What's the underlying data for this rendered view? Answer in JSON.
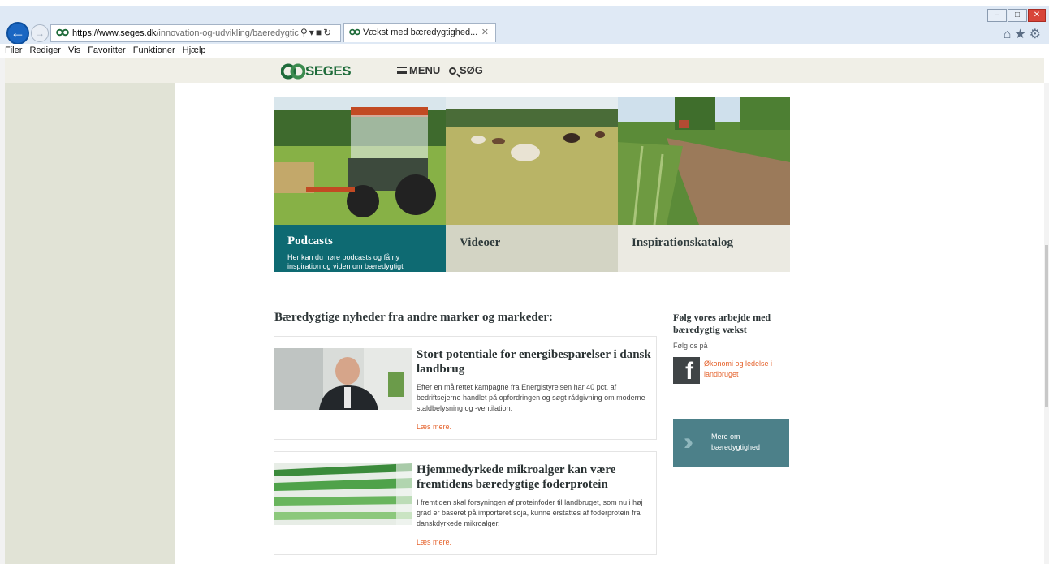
{
  "browser": {
    "url_host": "https://www.seges.dk",
    "url_path": "/innovation-og-udvikling/baeredygtic",
    "tab_title": "Vækst med bæredygtighed...",
    "menu": [
      "Filer",
      "Rediger",
      "Vis",
      "Favoritter",
      "Funktioner",
      "Hjælp"
    ]
  },
  "header": {
    "logo": "SEGES",
    "menu_label": "MENU",
    "search_label": "SØG"
  },
  "tiles": [
    {
      "title": "Podcasts",
      "description": "Her kan du høre podcasts og få ny inspiration og viden om bæredygtigt"
    },
    {
      "title": "Videoer"
    },
    {
      "title": "Inspirationskatalog"
    }
  ],
  "news": {
    "section_title": "Bæredygtige nyheder fra andre marker og markeder:",
    "items": [
      {
        "title": "Stort potentiale for energibesparelser i dansk landbrug",
        "body": "Efter en målrettet kampagne fra Energistyrelsen har 40 pct. af bedriftsejerne handlet på opfordringen og søgt rådgivning om moderne staldbelysning og -ventilation.",
        "more": "Læs mere."
      },
      {
        "title": "Hjemmedyrkede mikroalger kan være fremtidens bæredygtige foderprotein",
        "body": "I fremtiden skal forsyningen af proteinfoder til landbruget, som nu i høj grad er baseret på importeret soja, kunne erstattes af foderprotein fra danskdyrkede mikroalger.",
        "more": "Læs mere."
      }
    ]
  },
  "sidebar": {
    "follow_title": "Følg vores arbejde med bæredygtig vækst",
    "follow_sub": "Følg os på",
    "fb_link": "Økonomi og ledelse i landbruget",
    "more_label": "Mere om bæredygtighed"
  },
  "colors": {
    "podcast_teal": "#0e6a72",
    "more_box": "#4c8089",
    "link_orange": "#e5632d",
    "logo_green": "#1e6b3a"
  }
}
